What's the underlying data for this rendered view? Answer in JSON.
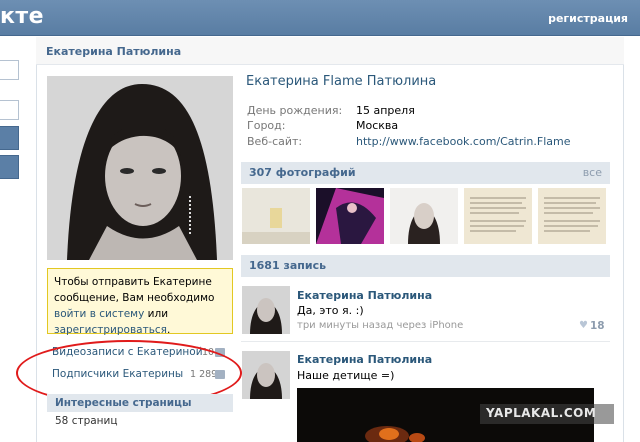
{
  "header": {
    "logo_text": "кте",
    "register_label": "регистрация"
  },
  "page": {
    "title": "Екатерина Патюлина"
  },
  "profile": {
    "name": "Екатерина Flame Патюлина",
    "fields": [
      {
        "label": "День рождения:",
        "value": "15 апреля"
      },
      {
        "label": "Город:",
        "value": "Москва"
      },
      {
        "label": "Веб-сайт:",
        "value": "http://www.facebook.com/Catrin.Flame"
      }
    ]
  },
  "notice": {
    "text_before": "Чтобы отправить Екатерине сообщение, Вам необходимо ",
    "login_link": "войти в систему",
    "text_middle": " или ",
    "register_link": "зарегистрироваться",
    "text_after": "."
  },
  "sidebar": {
    "videos_label": "Видеозаписи с Екатериной",
    "videos_count": "10",
    "subscribers_label": "Подписчики Екатерины",
    "subscribers_count": "1 289",
    "interesting_title": "Интересные страницы",
    "interesting_count": "58 страниц"
  },
  "photos": {
    "title": "307 фотографий",
    "all_label": "все"
  },
  "wall": {
    "title": "1681 запись",
    "posts": [
      {
        "author": "Екатерина Патюлина",
        "text": "Да, это я. :)",
        "meta": "три минуты назад через iPhone",
        "likes": "18"
      },
      {
        "author": "Екатерина Патюлина",
        "text": "Наше детище =)"
      }
    ]
  },
  "watermark": "YAPLAKAL.COM",
  "colors": {
    "header_blue": "#597da3",
    "link_blue": "#2b587a",
    "section_bg": "#e1e7ed",
    "notice_bg": "#fff9d7",
    "highlight_red": "#e01b1b"
  }
}
